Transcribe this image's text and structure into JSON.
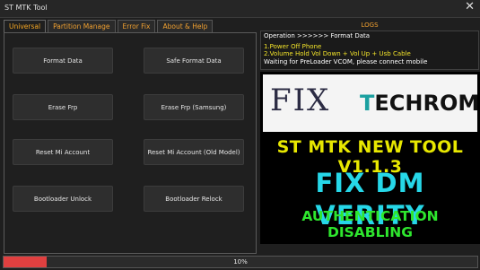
{
  "window": {
    "title": "ST MTK Tool",
    "close_glyph": "✕"
  },
  "tabs": [
    {
      "label": "Universal"
    },
    {
      "label": "Partition Manage"
    },
    {
      "label": "Error Fix"
    },
    {
      "label": "About & Help"
    }
  ],
  "buttons": {
    "format_data": "Format Data",
    "safe_format_data": "Safe Format Data",
    "erase_frp": "Erase Frp",
    "erase_frp_samsung": "Erase Frp (Samsung)",
    "reset_mi": "Reset Mi Account",
    "reset_mi_old": "Reset Mi Account (Old Model)",
    "bootloader_unlock": "Bootloader Unlock",
    "bootloader_relock": "Bootloader Relock"
  },
  "logs": {
    "label": "LOGS",
    "lines": [
      "Operation >>>>>> Format Data",
      "1.Power Off Phone",
      "2.Volume Hold Vol Down + Vol Up + Usb Cable",
      "Waiting for PreLoader VCOM, please connect mobile"
    ]
  },
  "banner": {
    "logo_fix": "FIX",
    "logo_techrom_t": "T",
    "logo_techrom_rest": "ECHROM",
    "line1": "ST MTK NEW TOOL V1.1.3",
    "line2": "FIX DM VERITY",
    "line3": "AUTHENTICATION DISABLING"
  },
  "progress": {
    "value": 10,
    "label": "10%"
  },
  "colors": {
    "accent_orange": "#f0a030",
    "log_yellow": "#f2e32a",
    "banner_yellow": "#e8e800",
    "banner_cyan": "#26d7e8",
    "banner_green": "#2ee62e",
    "progress_red": "#e04040"
  }
}
